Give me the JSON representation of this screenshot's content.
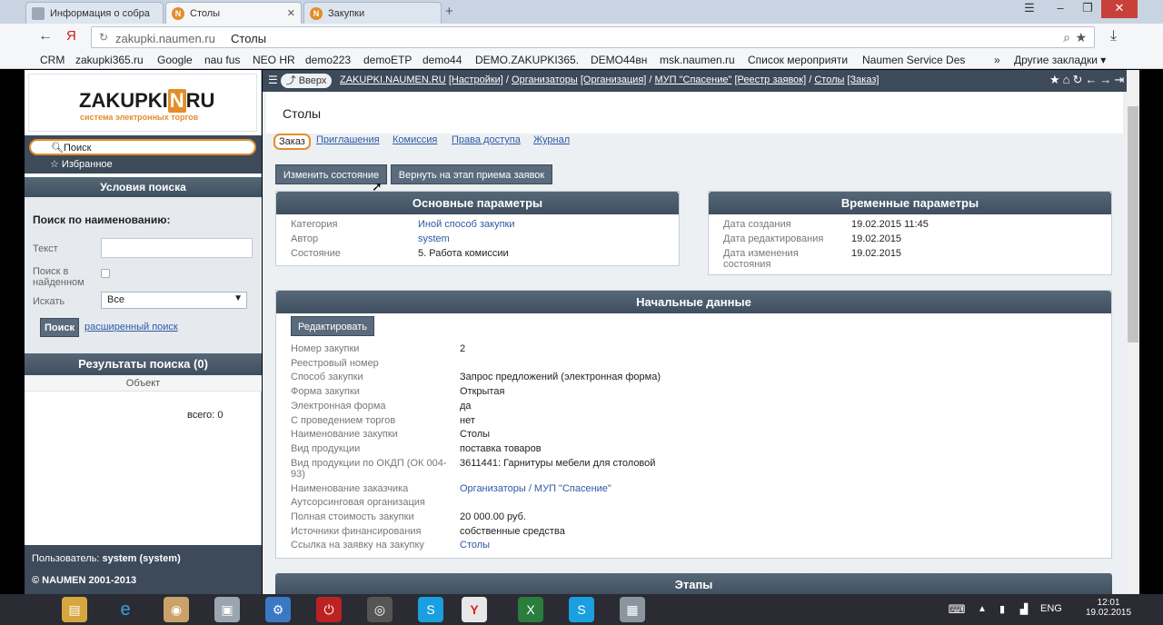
{
  "browser": {
    "tabs": [
      {
        "label": "Информация о собра",
        "active": false
      },
      {
        "label": "Столы",
        "active": true
      },
      {
        "label": "Закупки",
        "active": false
      }
    ],
    "url_host": "zakupki.naumen.ru",
    "url_title": "Столы",
    "bookmarks": [
      "CRM",
      "zakupki365.ru",
      "Google",
      "nau fus",
      "NEO HR",
      "demo223",
      "demoETP",
      "demo44",
      "DEMO.ZAKUPKI365.",
      "DEMO44вн",
      "msk.naumen.ru",
      "Список мероприяти",
      "Naumen Service Des",
      "»",
      "Другие закладки ▾"
    ]
  },
  "sidebar": {
    "logo": {
      "pre": "ZAKUPKI",
      "badge": "N",
      "post": "RU",
      "subtitle": "система электронных торгов"
    },
    "search_label": "Поиск",
    "favorites": "☆ Избранное",
    "search_conditions": {
      "header": "Условия поиска",
      "title": "Поиск по наименованию:",
      "text_label": "Текст",
      "text_value": "",
      "found_label_1": "Поиск в",
      "found_label_2": "найденном",
      "search_in_label": "Искать",
      "search_in_value": "Все",
      "search_button": "Поиск",
      "extended_link": "расширенный поиск"
    },
    "results": {
      "header": "Результаты поиска (0)",
      "column": "Объект",
      "total": "всего: 0"
    },
    "footer": {
      "user_prefix": "Пользователь:",
      "user": "system (system)",
      "copyright": "© NAUMEN 2001-2013"
    }
  },
  "main": {
    "up_button": "Вверх",
    "breadcrumbs": [
      {
        "label": "ZAKUPKI.NAUMEN.RU",
        "sep": " "
      },
      {
        "label": "[Настройки]",
        "sep": " / "
      },
      {
        "label": "Организаторы",
        "sep": " "
      },
      {
        "label": "[Организация]",
        "sep": " / "
      },
      {
        "label": "МУП \"Спасение\"",
        "sep": " "
      },
      {
        "label": "[Реестр заявок]",
        "sep": " / "
      },
      {
        "label": "Столы",
        "sep": " "
      },
      {
        "label": "[Заказ]",
        "sep": ""
      }
    ],
    "page_title": "Столы",
    "tabs": [
      "Заказ",
      "Приглашения",
      "Комиссия",
      "Права доступа",
      "Журнал"
    ],
    "buttons": {
      "change_state": "Изменить состояние",
      "return_stage": "Вернуть на этап приема заявок"
    },
    "main_params": {
      "header": "Основные параметры",
      "rows": [
        {
          "k": "Категория",
          "v": "Иной способ закупки",
          "link": true
        },
        {
          "k": "Автор",
          "v": "system",
          "link": true
        },
        {
          "k": "Состояние",
          "v": "5. Работа комиссии",
          "link": false
        }
      ]
    },
    "time_params": {
      "header": "Временные параметры",
      "rows": [
        {
          "k": "Дата создания",
          "v": "19.02.2015 11:45"
        },
        {
          "k": "Дата редактирования",
          "v": "19.02.2015"
        },
        {
          "k": "Дата изменения состояния",
          "v": "19.02.2015"
        }
      ]
    },
    "initial": {
      "header": "Начальные данные",
      "edit_button": "Редактировать",
      "rows": [
        {
          "k": "Номер закупки",
          "v": "2",
          "link": false
        },
        {
          "k": "Реестровый номер",
          "v": "",
          "link": false
        },
        {
          "k": "Способ закупки",
          "v": "Запрос предложений (электронная форма)",
          "link": false
        },
        {
          "k": "Форма закупки",
          "v": "Открытая",
          "link": false
        },
        {
          "k": "Электронная форма",
          "v": "да",
          "link": false
        },
        {
          "k": "С проведением торгов",
          "v": "нет",
          "link": false
        },
        {
          "k": "Наименование закупки",
          "v": "Столы",
          "link": false
        },
        {
          "k": "Вид продукции",
          "v": "поставка товаров",
          "link": false
        },
        {
          "k": "Вид продукции по ОКДП (ОК 004-93)",
          "v": "3611441: Гарнитуры мебели для столовой",
          "link": false
        },
        {
          "k": "Наименование заказчика",
          "v": "Организаторы / МУП \"Спасение\"",
          "link": true
        },
        {
          "k": "Аутсорсинговая организация",
          "v": "",
          "link": false
        },
        {
          "k": "Полная стоимость закупки",
          "v": "20 000.00 руб.",
          "link": false
        },
        {
          "k": "Источники финансирования",
          "v": "собственные средства",
          "link": false
        },
        {
          "k": "Ссылка на заявку на закупку",
          "v": "Столы",
          "link": true
        }
      ]
    },
    "stages_header": "Этапы"
  },
  "taskbar": {
    "lang": "ENG",
    "time": "12:01",
    "date": "19.02.2015"
  },
  "colors": {
    "accent": "#e38d2a",
    "header_dark": "#3c4a5a",
    "link": "#2d5aa5"
  }
}
